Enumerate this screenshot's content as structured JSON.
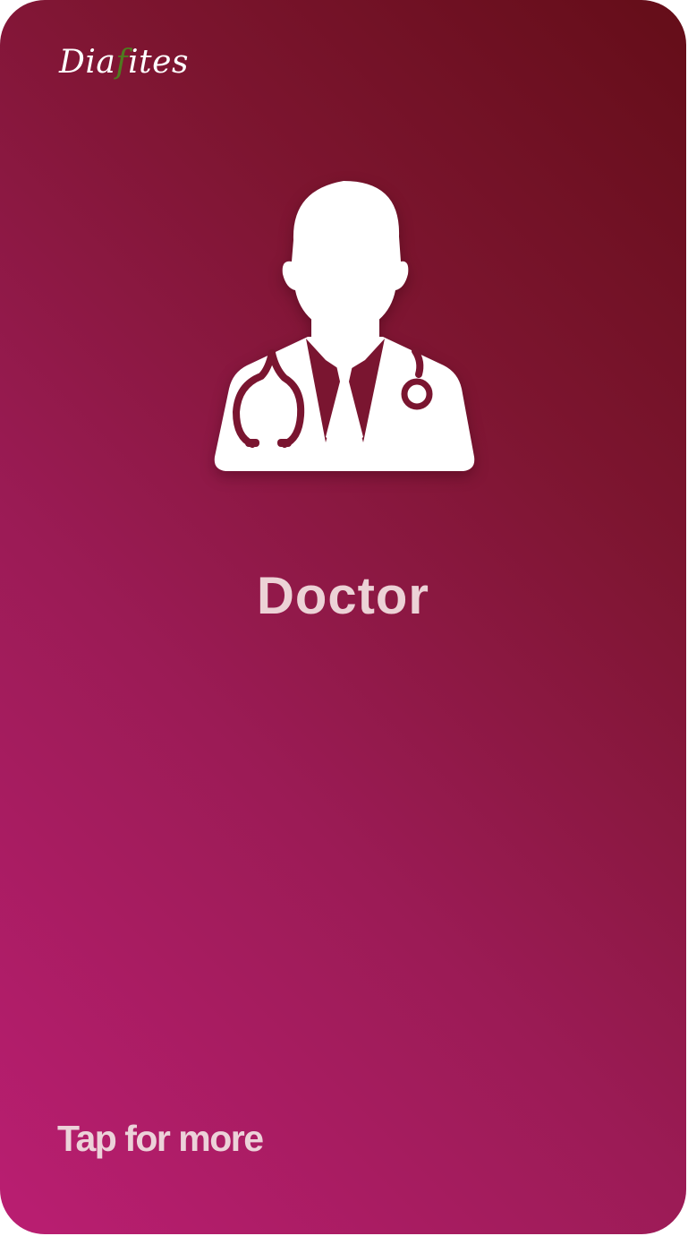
{
  "card": {
    "logo_prefix": "Dia",
    "logo_accent": "f",
    "logo_suffix": "ites",
    "icon": "doctor-icon",
    "title": "Doctor",
    "cta": "Tap for more"
  },
  "colors": {
    "gradient_dark": "#640d18",
    "gradient_light": "#ba1e72",
    "logo_accent": "#4f7a1f",
    "text": "#ecd2d6"
  }
}
